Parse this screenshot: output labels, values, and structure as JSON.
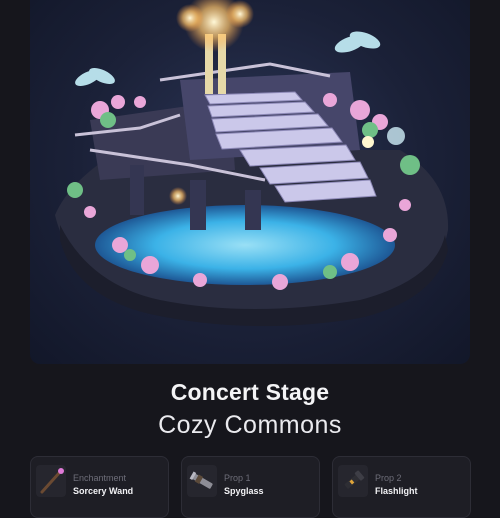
{
  "item": {
    "title": "Concert Stage",
    "subtitle": "Cozy Commons"
  },
  "slots": [
    {
      "category": "Enchantment",
      "name": "Sorcery Wand",
      "icon": "wand-icon"
    },
    {
      "category": "Prop 1",
      "name": "Spyglass",
      "icon": "spyglass-icon"
    },
    {
      "category": "Prop 2",
      "name": "Flashlight",
      "icon": "flashlight-icon"
    }
  ],
  "colors": {
    "background": "#16161c",
    "hero_background": "#1b2138",
    "water": "#4fd2ff",
    "stairs": "#c9c6e8",
    "flowers": "#e9a6d8"
  }
}
